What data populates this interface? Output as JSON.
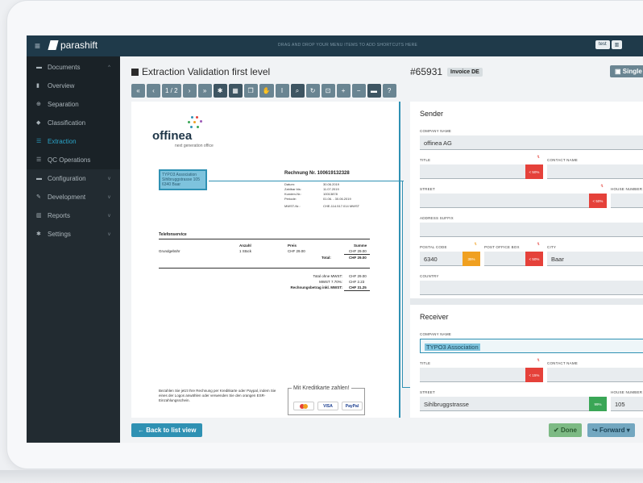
{
  "topbar": {
    "brand": "parashift",
    "hint": "DRAG AND DROP YOUR MENU ITEMS TO ADD SHORTCUTS HERE",
    "user": "test"
  },
  "sidebar": {
    "items": [
      {
        "label": "Documents",
        "icon": "folder-icon",
        "chevron": "^"
      },
      {
        "label": "Overview",
        "icon": "file-icon"
      },
      {
        "label": "Separation",
        "icon": "separation-icon"
      },
      {
        "label": "Classification",
        "icon": "tag-icon"
      },
      {
        "label": "Extraction",
        "icon": "list-icon"
      },
      {
        "label": "QC Operations",
        "icon": "list-icon"
      },
      {
        "label": "Configuration",
        "icon": "folder-icon",
        "chevron": "v"
      },
      {
        "label": "Development",
        "icon": "wrench-icon",
        "chevron": "v"
      },
      {
        "label": "Reports",
        "icon": "chart-icon",
        "chevron": "v"
      },
      {
        "label": "Settings",
        "icon": "gear-icon",
        "chevron": "v"
      }
    ]
  },
  "main": {
    "title": "Extraction Validation first level",
    "page_indicator": "1 / 2",
    "invoice_id": "#65931",
    "invoice_type": "Invoice DE",
    "single_label": "Single"
  },
  "document": {
    "logo": "offinea",
    "logo_sub": "next generation office",
    "selection_text": "TYPO3 Association Sihlbruggstrasse 105 6340 Baar",
    "rechnung": "Rechnung Nr. 100619132328",
    "meta_labels": [
      "Datum:",
      "Zahlbar bis:",
      "Kunden-Nr.:",
      "Periode:",
      "MWST-Nr.:"
    ],
    "meta_values": [
      "30.06.2019",
      "11.07.2019",
      "10013878",
      "01.06. - 30.06.2019",
      "CHE-114.517.014 MWST"
    ],
    "section": "Telefonservice",
    "table_headers": [
      "Anzahl",
      "Preis",
      "Summe"
    ],
    "row_item": "Grundgebühr",
    "row_qty": "1 Stück",
    "row_price": "CHF 29.00",
    "row_sum": "CHF 29.00",
    "total_label": "Total:",
    "total_value": "CHF 29.00",
    "totals": [
      {
        "label": "Total ohne MWST:",
        "value": "CHF 29.00"
      },
      {
        "label": "MWST 7.70%:",
        "value": "CHF 2.23"
      },
      {
        "label": "Rechnungsbetrag inkl. MWST:",
        "value": "CHF 31.25"
      }
    ],
    "bottom_text": "Bezahlen Sie jetzt Ihre Rechnung per Kreditkarte oder Paypal, indem Sie eines der Logos anwählen oder verwenden Sie den orangen ESR-Einzahlungsschein.",
    "kk_label": "Mit Kreditkarte zahlen!",
    "cards": [
      "VISA",
      "PayPal"
    ]
  },
  "form": {
    "sender_title": "Sender",
    "receiver_title": "Receiver",
    "labels": {
      "company": "COMPANY NAME",
      "title": "TITLE",
      "contact": "CONTACT NAME",
      "street": "STREET",
      "house": "HOUSE NUMBER",
      "suffix": "ADDRESS SUFFIX",
      "postal": "POSTAL CODE",
      "pobox": "POST OFFICE BOX",
      "city": "CITY",
      "country": "COUNTRY"
    },
    "sender": {
      "company": "offinea AG",
      "postal": "6340",
      "city": "Baar",
      "title_pct": "< 50%",
      "street_pct": "< 50%",
      "postal_pct": "35%",
      "pobox_pct": "< 50%"
    },
    "receiver": {
      "company": "TYPO3 Association",
      "street": "Sihlbruggstrasse",
      "house": "105",
      "title_pct": "< 15%",
      "house_pct": "99%"
    }
  },
  "footer": {
    "back": "Back to list view",
    "done": "Done",
    "forward": "Forward"
  }
}
